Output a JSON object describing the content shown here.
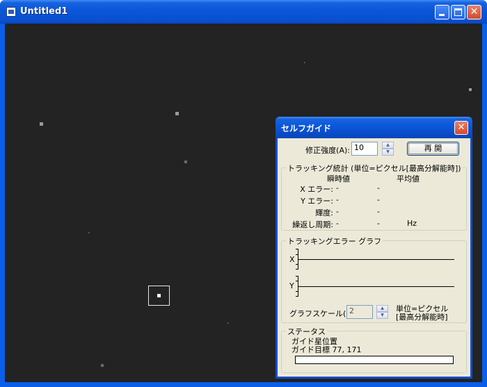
{
  "window": {
    "title": "Untitled1",
    "controls": [
      "minimize",
      "maximize",
      "close"
    ]
  },
  "image_view": {
    "background": "#232323",
    "reticle_color": "#e8e8e8"
  },
  "dialog": {
    "title": "セルフガイド",
    "correction": {
      "label": "修正強度(A):",
      "value": "10",
      "resume_button": "再 開"
    },
    "stats": {
      "group_title": "トラッキング統計 (単位=ピクセル[最高分解能時])",
      "col_instant": "瞬時値",
      "col_average": "平均値",
      "rows": [
        {
          "label": "X エラー:",
          "instant": "-",
          "average": "-"
        },
        {
          "label": "Y エラー:",
          "instant": "-",
          "average": "-"
        },
        {
          "label": "輝度:",
          "instant": "-",
          "average": "-"
        },
        {
          "label": "繰返し周期:",
          "instant": "-",
          "average": "-",
          "unit": "Hz"
        }
      ]
    },
    "graph": {
      "group_title": "トラッキングエラー グラフ",
      "x_label": "X",
      "y_label": "Y",
      "scale_label": "グラフスケール(G):",
      "scale_value": "2",
      "unit_line1": "単位=ピクセル",
      "unit_line2": "[最高分解能時]"
    },
    "status": {
      "group_title": "ステータス",
      "star_position": "ガイド星位置",
      "target": "ガイド目標 77, 171",
      "progress": 0
    }
  }
}
